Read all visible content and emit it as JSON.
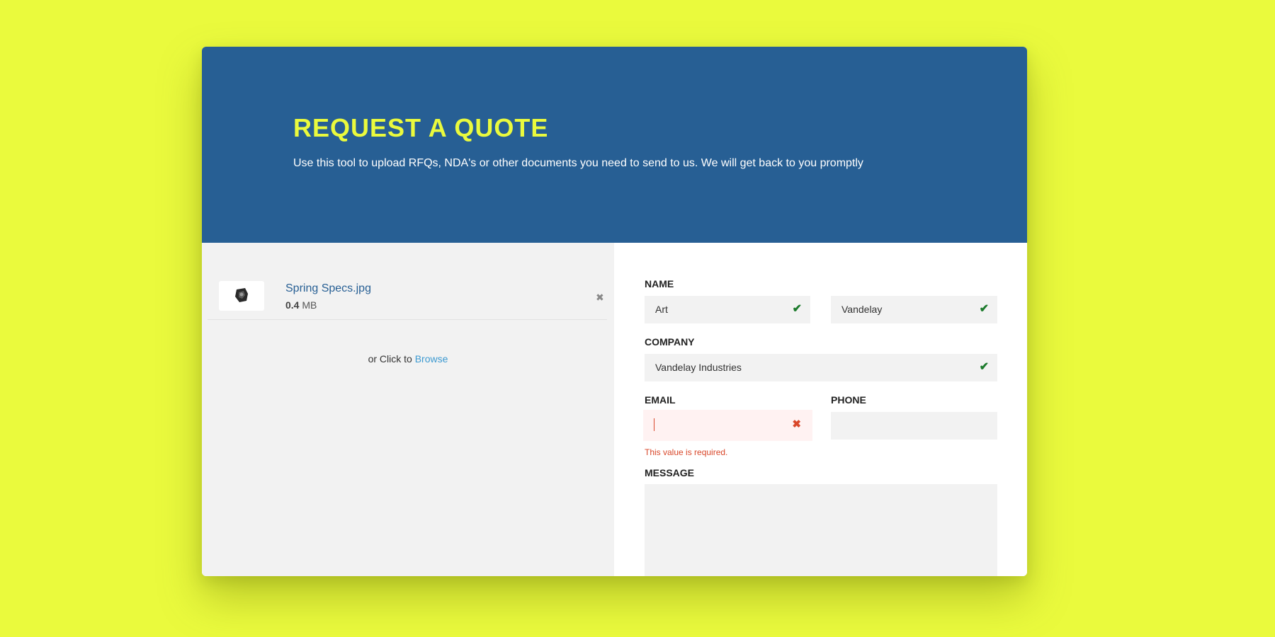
{
  "header": {
    "title": "REQUEST A QUOTE",
    "subtitle": "Use this tool to upload RFQs, NDA's or other documents you need to send to us. We will get back to you promptly"
  },
  "upload": {
    "file": {
      "name": "Spring Specs.jpg",
      "size_value": "0.4",
      "size_unit": "MB",
      "thumbnail_icon": "image-thumbnail-icon",
      "remove_icon": "close-icon"
    },
    "browse_prefix": "or Click to",
    "browse_link": "Browse"
  },
  "form": {
    "name": {
      "label": "NAME",
      "first": "Art",
      "last": "Vandelay"
    },
    "company": {
      "label": "COMPANY",
      "value": "Vandelay Industries"
    },
    "email": {
      "label": "EMAIL",
      "value": "",
      "error": "This value is required."
    },
    "phone": {
      "label": "PHONE",
      "value": ""
    },
    "message": {
      "label": "MESSAGE",
      "value": ""
    }
  },
  "colors": {
    "background": "#eafa3d",
    "header": "#275f94",
    "title": "#eafa3d",
    "valid": "#1b7a2b",
    "error": "#d9482b",
    "link": "#3d9ad1"
  }
}
